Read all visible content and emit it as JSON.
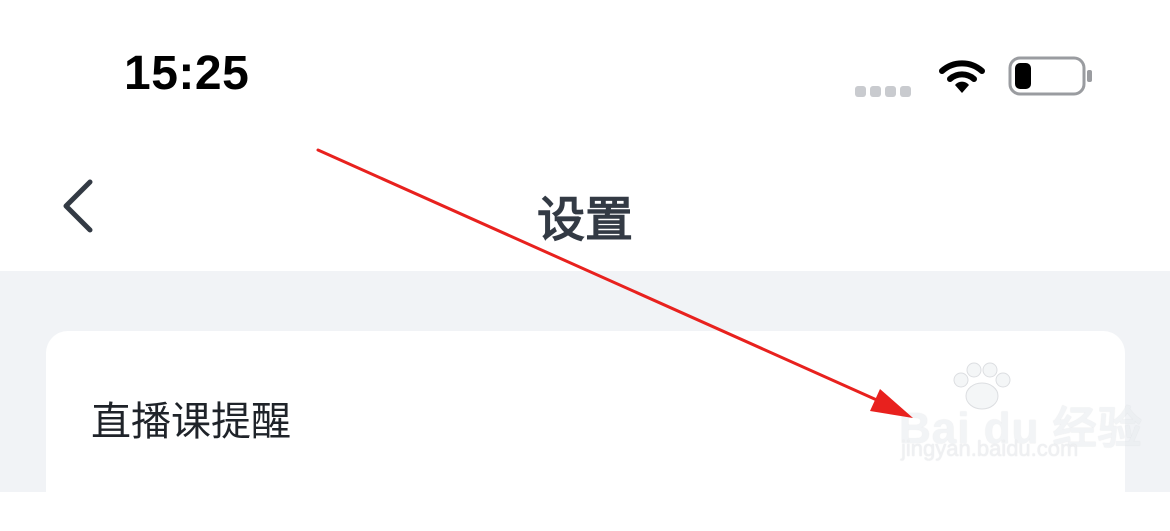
{
  "status_bar": {
    "time": "15:25",
    "wifi_icon": "wifi-icon",
    "battery_icon": "battery-icon",
    "battery_level": 0.2
  },
  "nav": {
    "title": "设置",
    "back_icon": "chevron-left-icon"
  },
  "settings": {
    "items": [
      {
        "label": "直播课提醒"
      }
    ]
  },
  "watermark": {
    "brand": "Bai du 经验",
    "url": "jingyan.baidu.com"
  },
  "colors": {
    "page_bg": "#f1f3f6",
    "card_bg": "#ffffff",
    "arrow": "#e8211e",
    "title_text": "#333a44"
  }
}
